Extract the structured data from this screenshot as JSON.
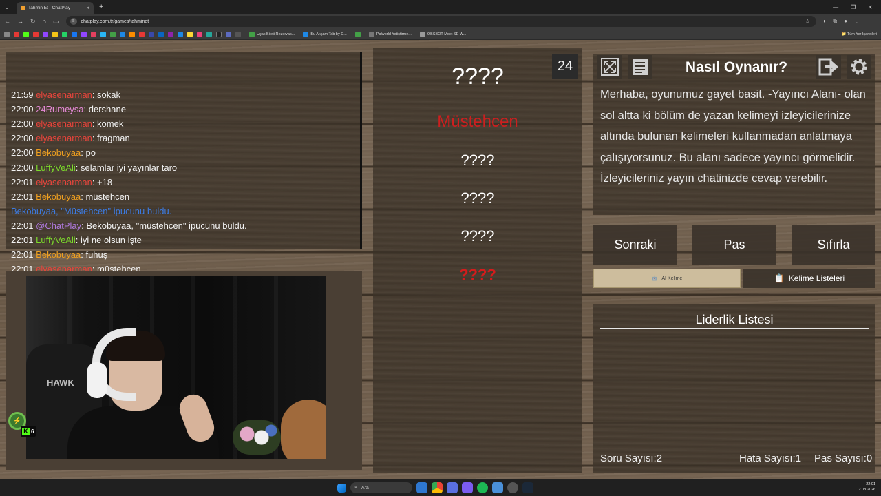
{
  "browser": {
    "tab_title": "Tahmin Et - ChatPlay",
    "url": "chatplay.com.tr/games/tahminet",
    "bookmarks": [
      "Uçak Bileti Rezervas...",
      "Bu Akşam Tab by D...",
      "Palworld Yetiştirme...",
      "OBSBOT Meet SE W..."
    ],
    "all_bookmarks": "Tüm Yer İşaretleri"
  },
  "chat": {
    "messages": [
      {
        "time": "21:59",
        "user": "elyasenarman",
        "text": ": sokak",
        "color": "#e8453c"
      },
      {
        "time": "22:00",
        "user": "24Rumeysa",
        "text": ": dershane",
        "color": "#e68ad8"
      },
      {
        "time": "22:00",
        "user": "elyasenarman",
        "text": ": komek",
        "color": "#e8453c"
      },
      {
        "time": "22:00",
        "user": "elyasenarman",
        "text": ": fragman",
        "color": "#e8453c"
      },
      {
        "time": "22:00",
        "user": "Bekobuyaa",
        "text": ": po",
        "color": "#f0a020"
      },
      {
        "time": "22:00",
        "user": "LuffyVeAli",
        "text": ": selamlar iyi yayınlar taro",
        "color": "#7ddc2c"
      },
      {
        "time": "22:01",
        "user": "elyasenarman",
        "text": ": +18",
        "color": "#e8453c"
      },
      {
        "time": "22:01",
        "user": "Bekobuyaa",
        "text": ": müstehcen",
        "color": "#f0a020"
      },
      {
        "time": "",
        "user": "Bekobuyaa, \"Müstehcen\"",
        "text": " ipucunu buldu.",
        "color": "#3d7be0",
        "system": true
      },
      {
        "time": "22:01",
        "user": "@ChatPlay",
        "text": ": Bekobuyaa, \"müstehcen\" ipucunu buldu.",
        "color": "#b07ae0"
      },
      {
        "time": "22:01",
        "user": "LuffyVeAli",
        "text": ": iyi ne olsun işte",
        "color": "#7ddc2c"
      },
      {
        "time": "22:01",
        "user": "Bekobuyaa",
        "text": ": fuhuş",
        "color": "#f0a020"
      },
      {
        "time": "22:01",
        "user": "elyasenarman",
        "text": ": müstehçen",
        "color": "#e8453c"
      }
    ]
  },
  "stream": {
    "chair_logo": "HAWK",
    "viewer_count": "6",
    "platform_icon": "kick-icon"
  },
  "game": {
    "timer": "24",
    "main_word": "????",
    "found_hint": "Müstehcen",
    "hints": [
      "????",
      "????",
      "????"
    ],
    "last_hint": "????",
    "colors": {
      "found": "#cc1f1f",
      "last": "#d41c1c"
    }
  },
  "howto": {
    "title": "Nasıl Oynanır?",
    "text": "Merhaba, oyunumuz gayet basit. -Yayıncı Alanı- olan sol altta ki bölüm de yazan kelimeyi izleyicilerinize altında bulunan kelimeleri kullanmadan anlatmaya çalışıyorsunuz. Bu alanı sadece yayıncı görmelidir. İzleyicileriniz yayın chatinizde cevap verebilir."
  },
  "controls": {
    "next": "Sonraki",
    "pass": "Pas",
    "reset": "Sıfırla",
    "ai_word": "AI Kelime",
    "word_lists": "Kelime Listeleri"
  },
  "leaderboard": {
    "title": "Liderlik Listesi"
  },
  "stats": {
    "question_label": "Soru Sayısı:",
    "question_value": "2",
    "error_label": "Hata Sayısı:",
    "error_value": "1",
    "pass_label": "Pas Sayısı:",
    "pass_value": "0"
  },
  "taskbar": {
    "search": "Ara",
    "time": "22:01",
    "date": "2.08.2026"
  }
}
